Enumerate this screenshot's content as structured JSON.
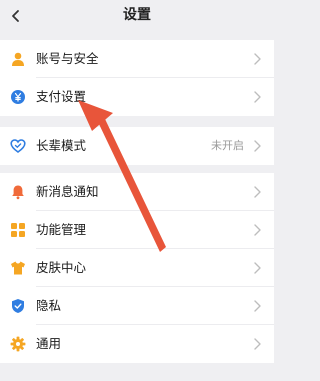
{
  "header": {
    "title": "设置"
  },
  "group1": [
    {
      "label": "账号与安全",
      "icon": "user-icon",
      "color": "#f5a623"
    },
    {
      "label": "支付设置",
      "icon": "yuan-coin-icon",
      "color": "#2f7de1"
    }
  ],
  "group2": [
    {
      "label": "长辈模式",
      "status": "未开启",
      "icon": "heart-care-icon",
      "color": "#2f7de1"
    }
  ],
  "group3": [
    {
      "label": "新消息通知",
      "icon": "bell-icon",
      "color": "#f06a3a"
    },
    {
      "label": "功能管理",
      "icon": "grid-icon",
      "color": "#f5a623"
    },
    {
      "label": "皮肤中心",
      "icon": "shirt-icon",
      "color": "#f5a623"
    },
    {
      "label": "隐私",
      "icon": "shield-icon",
      "color": "#2f7de1"
    },
    {
      "label": "通用",
      "icon": "gear-icon",
      "color": "#f5a623"
    }
  ],
  "annotation": {
    "icon": "red-arrow-icon",
    "color": "#e8553a"
  }
}
